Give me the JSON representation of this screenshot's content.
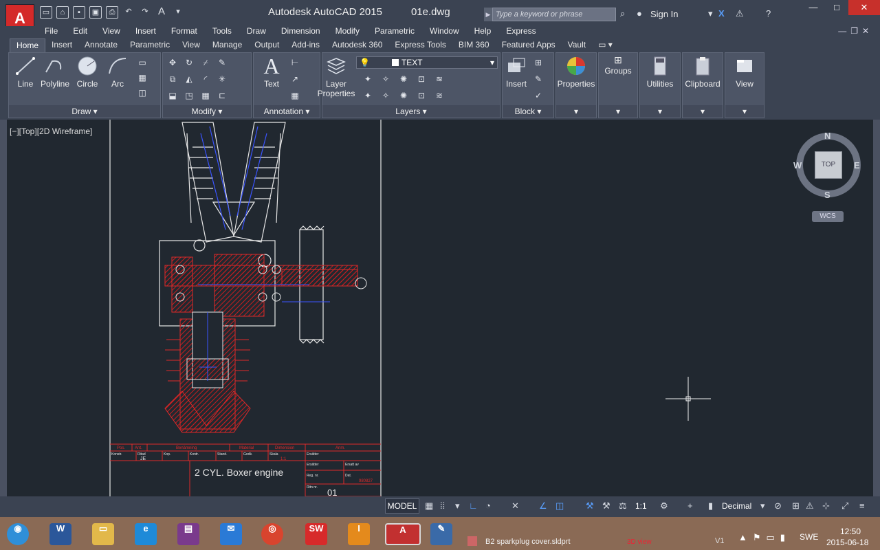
{
  "titlebar": {
    "app_name": "Autodesk AutoCAD 2015",
    "file_name": "01e.dwg",
    "search_placeholder": "Type a keyword or phrase",
    "sign_in": "Sign In"
  },
  "menubar": {
    "items": [
      "File",
      "Edit",
      "View",
      "Insert",
      "Format",
      "Tools",
      "Draw",
      "Dimension",
      "Modify",
      "Parametric",
      "Window",
      "Help",
      "Express"
    ]
  },
  "ribbon": {
    "tabs": [
      "Home",
      "Insert",
      "Annotate",
      "Parametric",
      "View",
      "Manage",
      "Output",
      "Add-ins",
      "Autodesk 360",
      "Express Tools",
      "BIM 360",
      "Featured Apps",
      "Vault"
    ],
    "active_tab": "Home",
    "draw": {
      "title": "Draw",
      "line": "Line",
      "polyline": "Polyline",
      "circle": "Circle",
      "arc": "Arc"
    },
    "modify": {
      "title": "Modify"
    },
    "annotation": {
      "title": "Annotation",
      "text": "Text"
    },
    "layers": {
      "title": "Layers",
      "layer_properties_1": "Layer",
      "layer_properties_2": "Properties",
      "current_layer": "TEXT"
    },
    "block": {
      "title": "Block",
      "insert": "Insert"
    },
    "properties": "Properties",
    "groups": "Groups",
    "utilities": "Utilities",
    "clipboard": "Clipboard",
    "view": "View"
  },
  "viewport": {
    "label": "[−][Top][2D Wireframe]"
  },
  "drawing": {
    "title_block": {
      "headers": [
        "Pos.",
        "Ant.",
        "Benämning",
        "Material",
        "Dimension",
        "Anm."
      ],
      "row2": [
        "Konstr.",
        "Ritad",
        "Kop.",
        "Kontr.",
        "Stand.",
        "Godk.",
        "Skala",
        "Ersätter"
      ],
      "drawn_by": "JE",
      "scale": "1:1",
      "title": "2 CYL. Boxer engine",
      "erstatt": "Ersätter",
      "erstatt_av": "Ersatt av",
      "reg_nr": "Reg. nr.",
      "dat": "Dat.",
      "date_val": "980827",
      "ritn_nr": "Ritn nr.",
      "drawing_number": "01"
    }
  },
  "viewcube": {
    "north": "N",
    "south": "S",
    "east": "E",
    "west": "W",
    "face": "TOP",
    "wcs": "WCS"
  },
  "statusbar": {
    "model": "MODEL",
    "scale": "1:1",
    "units": "Decimal"
  },
  "taskbar": {
    "peek_file": "B2 sparkplug cover.sldprt",
    "peek_view": "3D view",
    "peek_v1": "V1",
    "language": "SWE",
    "time": "12:50",
    "date": "2015-06-18"
  }
}
